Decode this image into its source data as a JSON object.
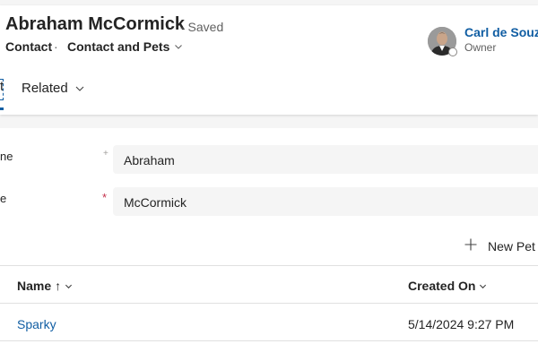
{
  "header": {
    "title": "Abraham McCormick",
    "save_status": "- Saved",
    "entity": "Contact",
    "separator": "·",
    "form_name": "Contact and Pets",
    "owner": {
      "name": "Carl de Souza",
      "role": "Owner"
    }
  },
  "tabs": {
    "partial_active": "t",
    "related": "Related"
  },
  "fields": [
    {
      "label": "ne",
      "value": "Abraham",
      "required_marker": "+"
    },
    {
      "label": "e",
      "value": "McCormick",
      "required_marker": "*"
    }
  ],
  "subgrid": {
    "new_button": "New Pet",
    "columns": [
      {
        "label": "Name",
        "sort": "↑"
      },
      {
        "label": "Created On"
      }
    ],
    "rows": [
      {
        "name": "Sparky",
        "created_on": "5/14/2024 9:27 PM"
      }
    ]
  },
  "colors": {
    "link": "#115ea3",
    "required": "#c4314b",
    "background": "#f5f5f5"
  }
}
